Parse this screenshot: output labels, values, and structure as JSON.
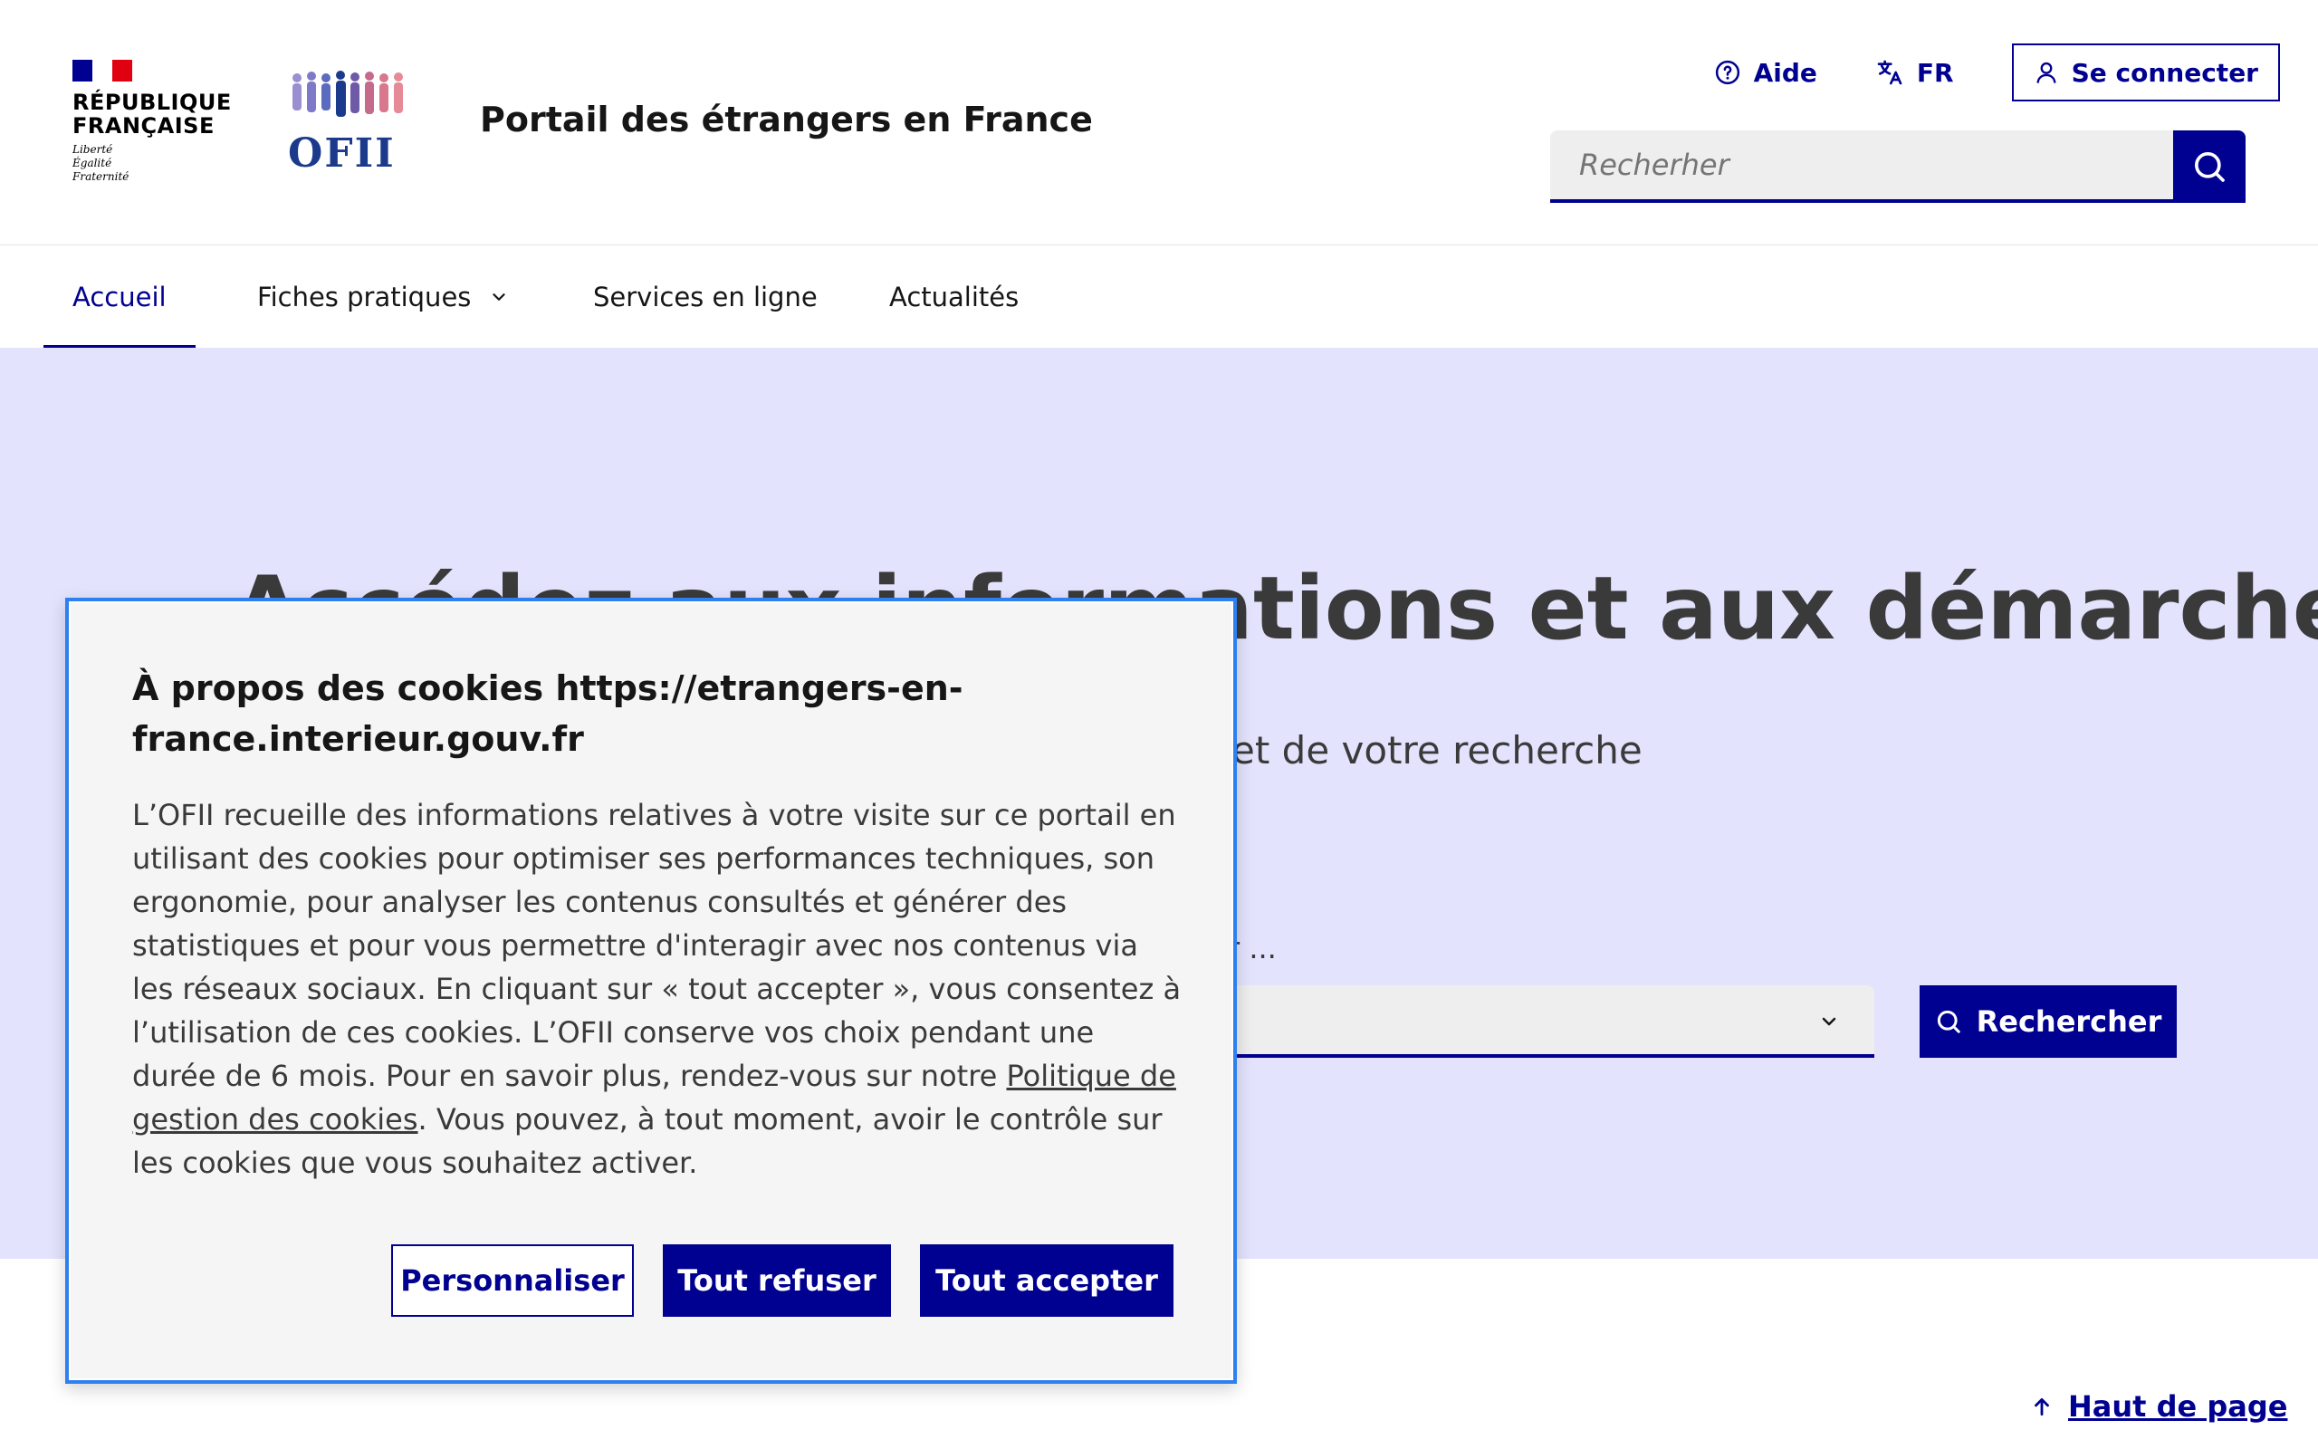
{
  "header": {
    "republic_line1": "RÉPUBLIQUE",
    "republic_line2": "FRANÇAISE",
    "motto": [
      "Liberté",
      "Égalité",
      "Fraternité"
    ],
    "ofii_logo_text": "OFII",
    "service_title": "Portail des étrangers en France",
    "help_label": "Aide",
    "language_label": "FR",
    "login_label": "Se connecter",
    "search_placeholder": "Recherher"
  },
  "nav": {
    "items": [
      {
        "label": "Accueil",
        "active": true
      },
      {
        "label": "Fiches pratiques",
        "has_dropdown": true
      },
      {
        "label": "Services en ligne"
      },
      {
        "label": "Actualités"
      }
    ]
  },
  "hero": {
    "title": "Accédez aux informations et aux démarches",
    "subtitle_visible": "et de votre recherche",
    "field_label_visible": "r ...",
    "search_button": "Rechercher"
  },
  "cookie": {
    "title": "À propos des cookies https://etrangers-en-france.interieur.gouv.fr",
    "body_before_link": "L’OFII recueille des informations relatives à votre visite sur ce portail en utilisant des cookies pour optimiser ses performances techniques, son ergonomie, pour analyser les contenus consultés et générer des statistiques et pour vous permettre d'interagir avec nos contenus via les réseaux sociaux. En cliquant sur « tout accepter », vous consentez à l’utilisation de ces cookies. L’OFII conserve vos choix pendant une durée de 6 mois. Pour en savoir plus, rendez-vous sur notre ",
    "link_label": "Politique de gestion des cookies",
    "body_after_link": ". Vous pouvez, à tout moment, avoir le contrôle sur les cookies que vous souhaitez activer.",
    "customize_label": "Personnaliser",
    "refuse_label": "Tout refuser",
    "accept_label": "Tout accepter"
  },
  "footer": {
    "back_to_top": "Haut de page"
  },
  "colors": {
    "primary": "#000091",
    "hero_bg": "#e3e3fd",
    "dialog_border": "#2e7ff0"
  }
}
